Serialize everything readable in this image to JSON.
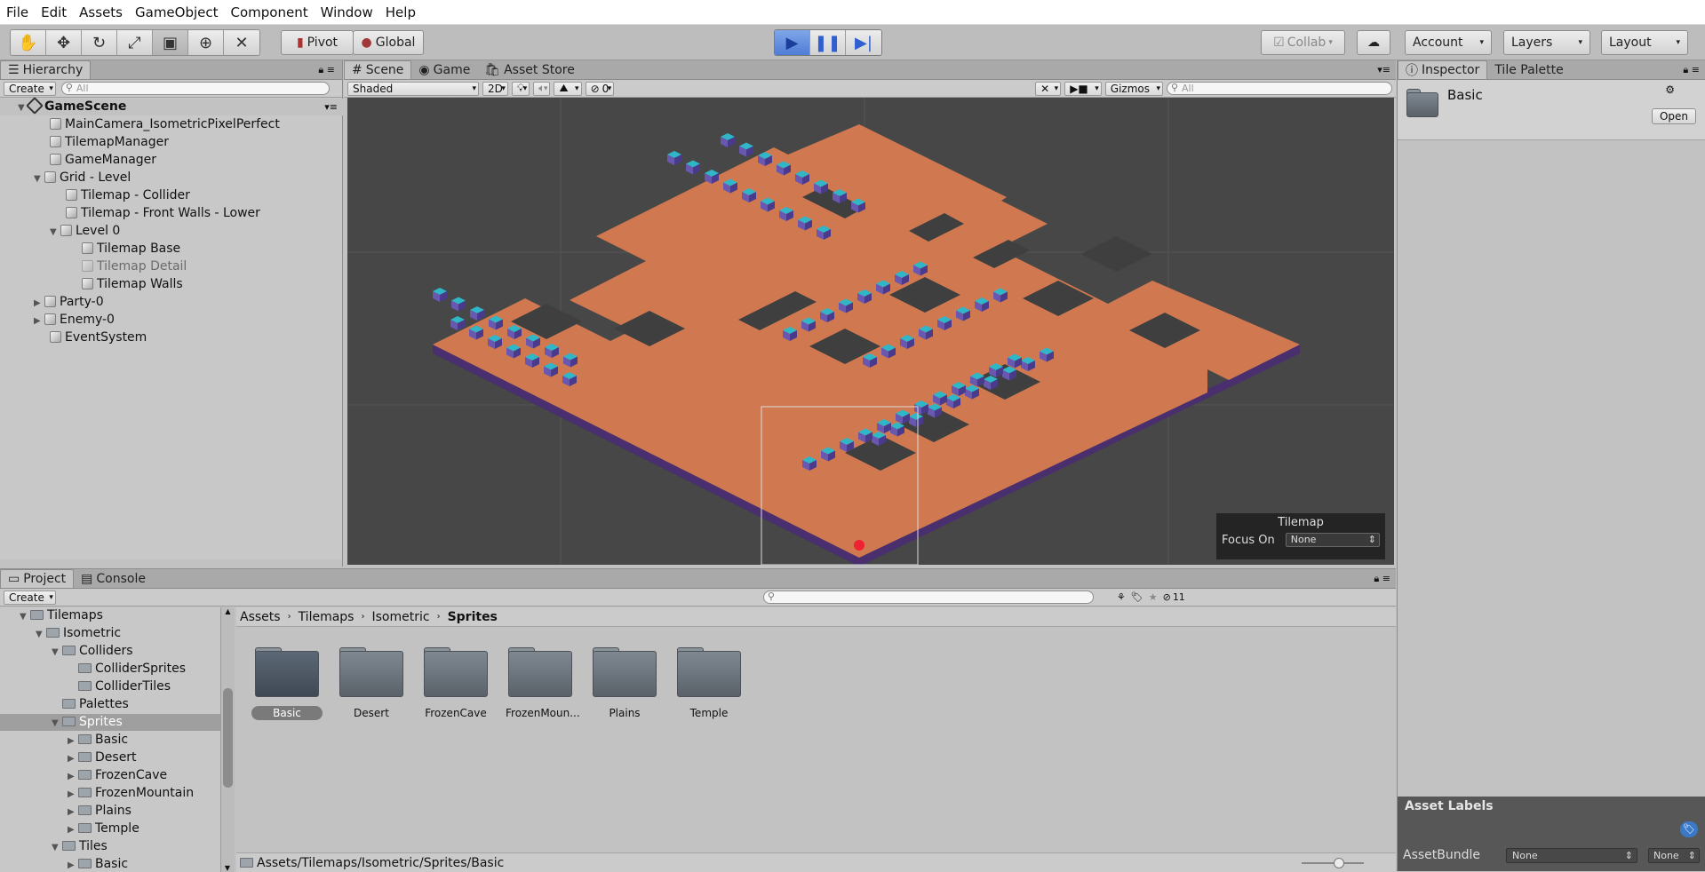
{
  "menu": [
    "File",
    "Edit",
    "Assets",
    "GameObject",
    "Component",
    "Window",
    "Help"
  ],
  "toolbar": {
    "pivot": "Pivot",
    "global": "Global",
    "collab": "Collab",
    "account": "Account",
    "layers": "Layers",
    "layout": "Layout"
  },
  "hierarchy": {
    "tab": "Hierarchy",
    "create": "Create",
    "search_placeholder": "All",
    "scene": "GameScene",
    "items": [
      "MainCamera_IsometricPixelPerfect",
      "TilemapManager",
      "GameManager",
      "Grid - Level",
      "Tilemap - Collider",
      "Tilemap - Front Walls - Lower",
      "Level 0",
      "Tilemap Base",
      "Tilemap Detail",
      "Tilemap Walls",
      "Party-0",
      "Enemy-0",
      "EventSystem"
    ]
  },
  "scene_tabs": {
    "scene": "Scene",
    "game": "Game",
    "asset_store": "Asset Store",
    "shading": "Shaded",
    "mode_2d": "2D",
    "hidden_count": "0",
    "gizmos": "Gizmos",
    "search_placeholder": "All"
  },
  "tilemap_overlay": {
    "title": "Tilemap",
    "focus_label": "Focus On",
    "focus_value": "None"
  },
  "inspector": {
    "tab": "Inspector",
    "tab2": "Tile Palette",
    "asset_name": "Basic",
    "open": "Open",
    "labels_title": "Asset Labels",
    "assetbundle_label": "AssetBundle",
    "assetbundle_value": "None",
    "variant_value": "None"
  },
  "project": {
    "tab": "Project",
    "tab2": "Console",
    "create": "Create",
    "hidden_count": "11",
    "tree": [
      "Tilemaps",
      "Isometric",
      "Colliders",
      "ColliderSprites",
      "ColliderTiles",
      "Palettes",
      "Sprites",
      "Basic",
      "Desert",
      "FrozenCave",
      "FrozenMountain",
      "Plains",
      "Temple",
      "Tiles",
      "Basic"
    ],
    "breadcrumb": [
      "Assets",
      "Tilemaps",
      "Isometric",
      "Sprites"
    ],
    "assets": [
      "Basic",
      "Desert",
      "FrozenCave",
      "FrozenMoun...",
      "Plains",
      "Temple"
    ],
    "path": "Assets/Tilemaps/Isometric/Sprites/Basic"
  },
  "colors": {
    "floor": "#d07850",
    "wall": "#4a2f6e",
    "pillar_top": "#2fb7c8",
    "pillar_side": "#5f4aa0",
    "scene_bg": "#474747"
  }
}
